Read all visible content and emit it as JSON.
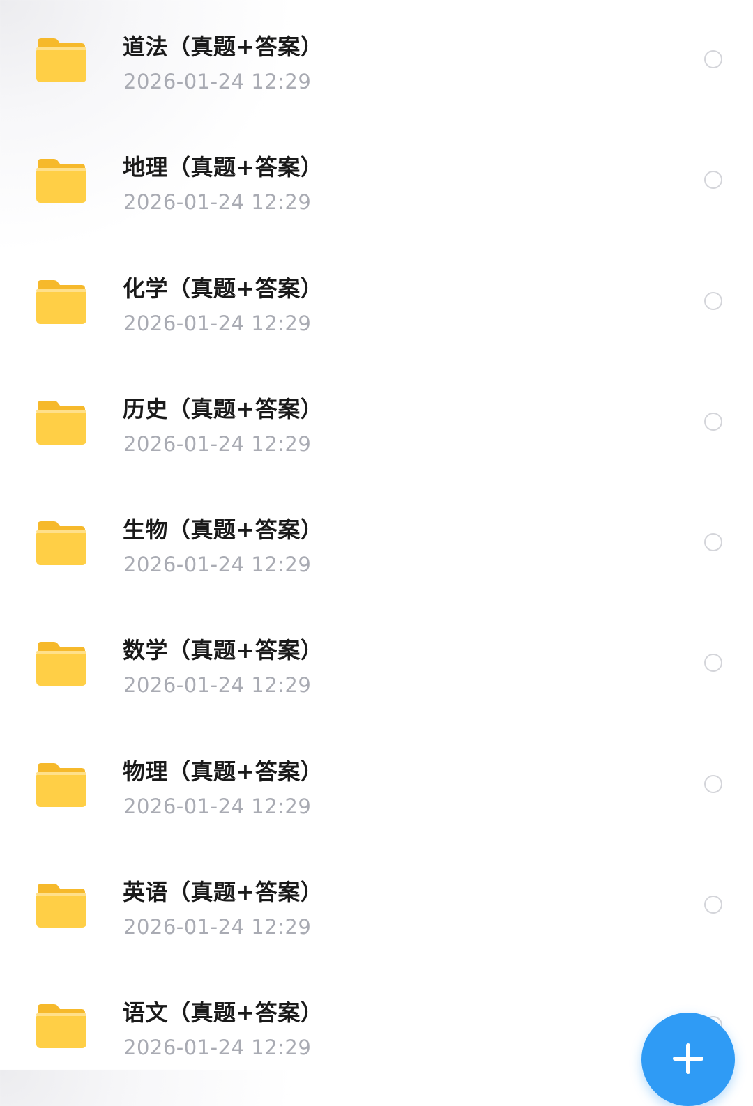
{
  "colors": {
    "folder": "#ffc83a",
    "date_text": "#a9abb3",
    "name_text": "#1a1a1a",
    "fab": "#2f9bf5"
  },
  "files": [
    {
      "name": "道法（真题+答案）",
      "date": "2026-01-24 12:29",
      "icon": "folder-icon"
    },
    {
      "name": "地理（真题+答案）",
      "date": "2026-01-24 12:29",
      "icon": "folder-icon"
    },
    {
      "name": "化学（真题+答案）",
      "date": "2026-01-24 12:29",
      "icon": "folder-icon"
    },
    {
      "name": "历史（真题+答案）",
      "date": "2026-01-24 12:29",
      "icon": "folder-icon"
    },
    {
      "name": "生物（真题+答案）",
      "date": "2026-01-24 12:29",
      "icon": "folder-icon"
    },
    {
      "name": "数学（真题+答案）",
      "date": "2026-01-24 12:29",
      "icon": "folder-icon"
    },
    {
      "name": "物理（真题+答案）",
      "date": "2026-01-24 12:29",
      "icon": "folder-icon"
    },
    {
      "name": "英语（真题+答案）",
      "date": "2026-01-24 12:29",
      "icon": "folder-icon"
    },
    {
      "name": "语文（真题+答案）",
      "date": "2026-01-24 12:29",
      "icon": "folder-icon"
    }
  ],
  "fab": {
    "icon": "plus-icon"
  }
}
